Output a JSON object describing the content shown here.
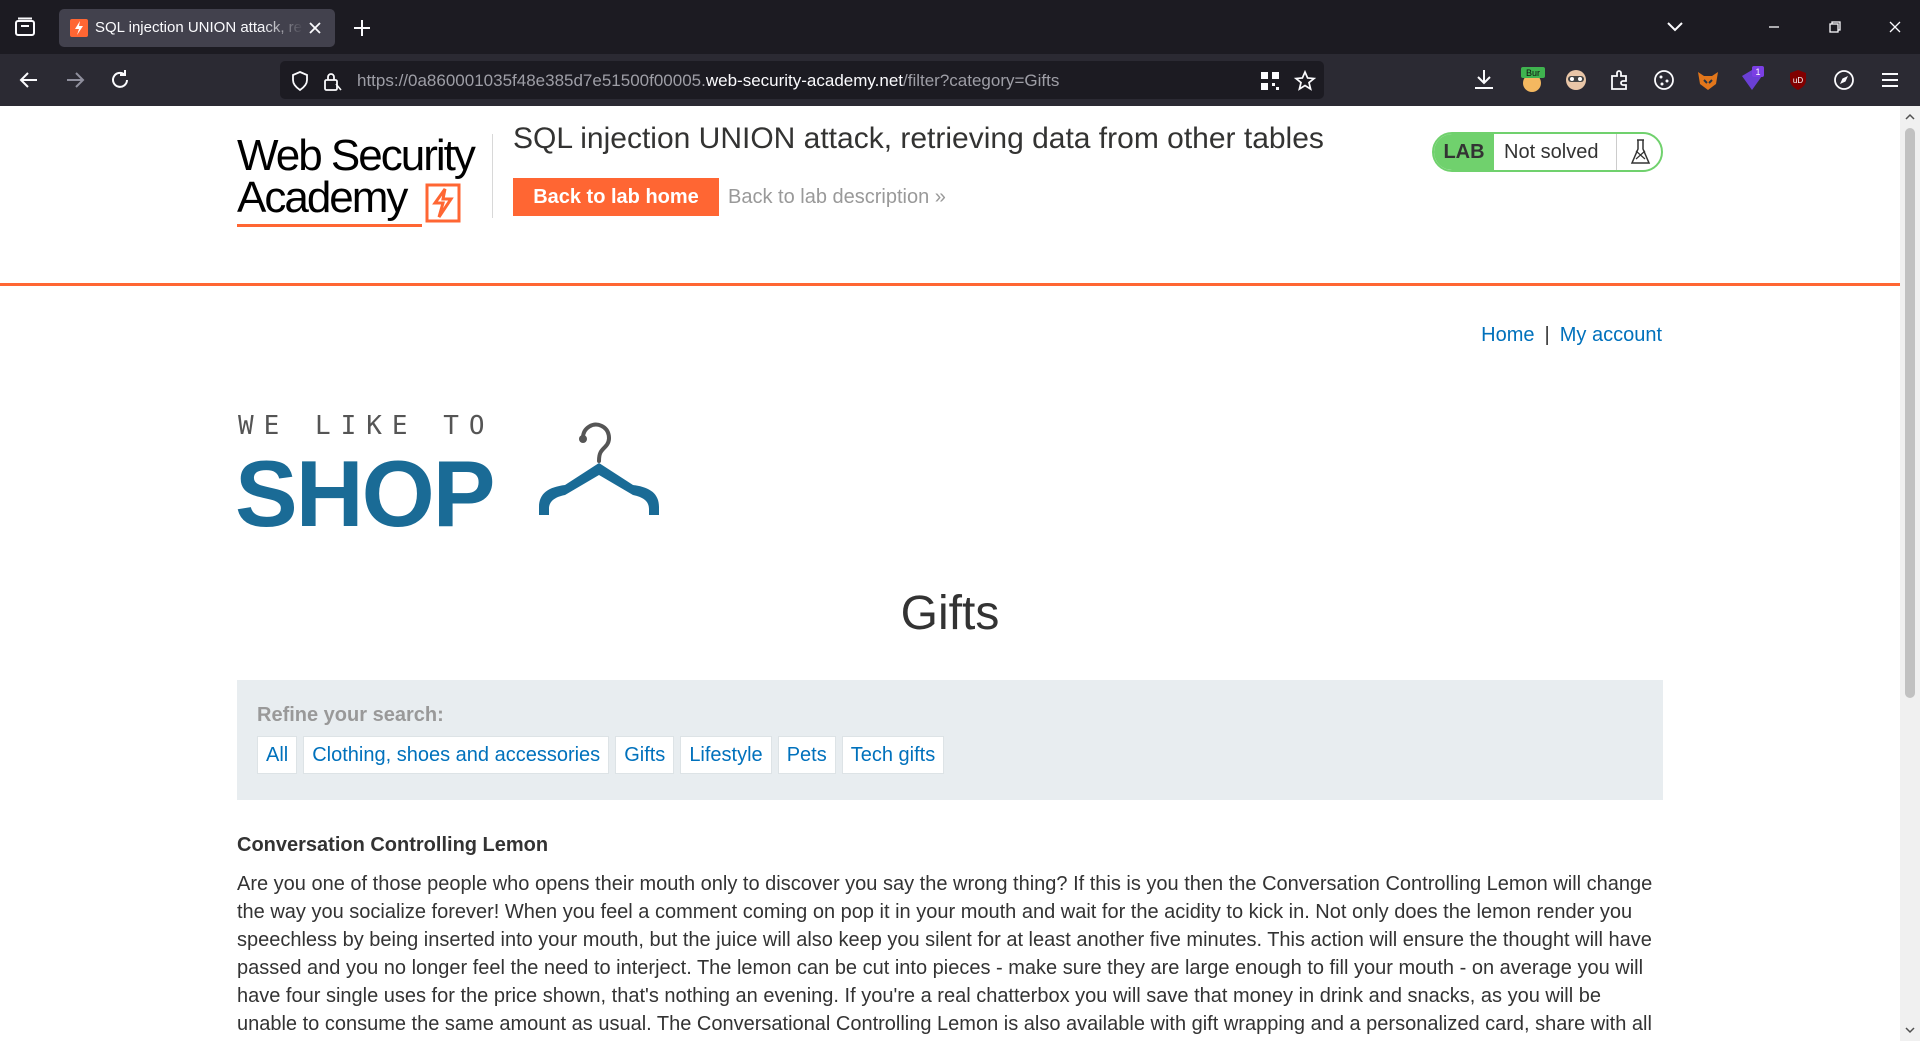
{
  "browser": {
    "tab_title": "SQL injection UNION attack, retrieving data from other tables",
    "url_prefix": "https://0a860001035f48e385d7e51500f00005.",
    "url_domain": "web-security-academy.net",
    "url_path": "/filter?category=Gifts",
    "colors": {
      "chrome_dark": "#1c1b22",
      "toolbar": "#2b2a33",
      "tab_active": "#42414d"
    },
    "extensions": [
      "download-icon",
      "burp-icon",
      "mask-icon",
      "puzzle-icon",
      "cookie-icon",
      "fox-icon",
      "badge-icon",
      "ublock-icon",
      "compass-icon",
      "menu-icon"
    ],
    "extension_labels": {
      "burp": "Bur",
      "badge": "1",
      "ublock": "uD"
    }
  },
  "academy": {
    "logo_line1": "Web Security",
    "logo_line2": "Academy",
    "lab_title": "SQL injection UNION attack, retrieving data from other tables",
    "back_home_label": "Back to lab home",
    "back_description_label": "Back to lab description",
    "back_description_chevron": "»",
    "lab_badge": "LAB",
    "lab_status": "Not solved",
    "colors": {
      "accent": "#ff6633",
      "status_green": "#70d16d",
      "link": "#0071bc"
    }
  },
  "nav": {
    "home": "Home",
    "separator": "|",
    "my_account": "My account"
  },
  "shop": {
    "tagline": "WE LIKE TO",
    "name": "SHOP",
    "brand_color": "#1a6b96"
  },
  "main": {
    "category_title": "Gifts",
    "filter": {
      "label": "Refine your search:",
      "categories": [
        "All",
        "Clothing, shoes and accessories",
        "Gifts",
        "Lifestyle",
        "Pets",
        "Tech gifts"
      ]
    },
    "product": {
      "name": "Conversation Controlling Lemon",
      "description": "Are you one of those people who opens their mouth only to discover you say the wrong thing? If this is you then the Conversation Controlling Lemon will change the way you socialize forever! When you feel a comment coming on pop it in your mouth and wait for the acidity to kick in. Not only does the lemon render you speechless by being inserted into your mouth, but the juice will also keep you silent for at least another five minutes. This action will ensure the thought will have passed and you no longer feel the need to interject. The lemon can be cut into pieces - make sure they are large enough to fill your mouth - on average you will have four single uses for the price shown, that's nothing an evening. If you're a real chatterbox you will save that money in drink and snacks, as you will be unable to consume the same amount as usual. The Conversational Controlling Lemon is also available with gift wrapping and a personalized card, share with all"
    }
  }
}
